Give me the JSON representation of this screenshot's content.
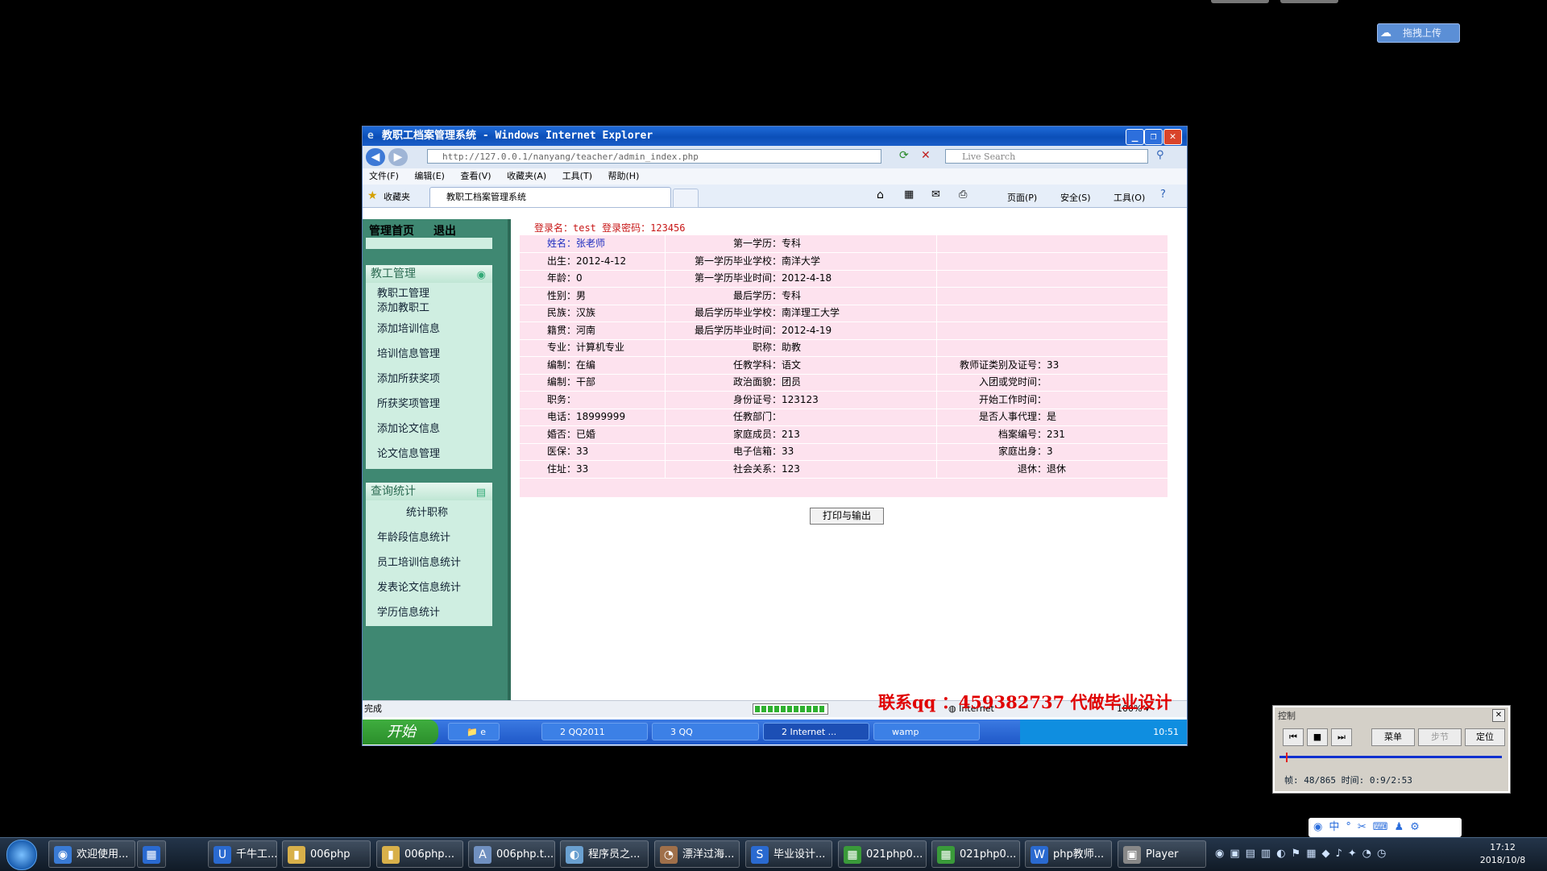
{
  "desktop": {
    "upload_label": "拖拽上传"
  },
  "ie": {
    "title": "教职工档案管理系统 - Windows Internet Explorer",
    "url": "http://127.0.0.1/nanyang/teacher/admin_index.php",
    "search_placeholder": "Live Search",
    "menu": [
      "文件(F)",
      "编辑(E)",
      "查看(V)",
      "收藏夹(A)",
      "工具(T)",
      "帮助(H)"
    ],
    "favorites_label": "收藏夹",
    "tab_title": "教职工档案管理系统",
    "commands": [
      "页面(P)",
      "安全(S)",
      "工具(O)"
    ],
    "status_text": "完成",
    "zone": "Internet",
    "zoom": "100%",
    "watermark": "联系qq ：459382737  代做毕业设计"
  },
  "page": {
    "top_nav": [
      "管理首页",
      "退出"
    ],
    "panel1": {
      "title": "教工管理",
      "items": [
        "教职工管理",
        "添加教职工",
        "添加培训信息",
        "培训信息管理",
        "添加所获奖项",
        "所获奖项管理",
        "添加论文信息",
        "论文信息管理"
      ]
    },
    "panel2": {
      "title": "查询统计",
      "items": [
        "统计职称",
        "年龄段信息统计",
        "员工培训信息统计",
        "发表论文信息统计",
        "学历信息统计"
      ]
    },
    "credentials": "登录名：test 登录密码：123456",
    "rows": [
      {
        "c1": "姓名：张老师",
        "l2": "第一学历：",
        "v2": "专科",
        "l3": "",
        "v3": ""
      },
      {
        "c1": "出生：2012-4-12",
        "l2": "第一学历毕业学校：",
        "v2": "南洋大学",
        "l3": "",
        "v3": ""
      },
      {
        "c1": "年龄：0",
        "l2": "第一学历毕业时间：",
        "v2": "2012-4-18",
        "l3": "",
        "v3": ""
      },
      {
        "c1": "性别：男",
        "l2": "最后学历：",
        "v2": "专科",
        "l3": "",
        "v3": ""
      },
      {
        "c1": "民族：汉族",
        "l2": "最后学历毕业学校：",
        "v2": "南洋理工大学",
        "l3": "",
        "v3": ""
      },
      {
        "c1": "籍贯：河南",
        "l2": "最后学历毕业时间：",
        "v2": "2012-4-19",
        "l3": "",
        "v3": ""
      },
      {
        "c1": "专业：计算机专业",
        "l2": "职称：",
        "v2": "助教",
        "l3": "",
        "v3": ""
      },
      {
        "c1": "编制：在编",
        "l2": "任教学科：",
        "v2": "语文",
        "l3": "教师证类别及证号：",
        "v3": "33"
      },
      {
        "c1": "编制：干部",
        "l2": "政治面貌：",
        "v2": "团员",
        "l3": "入团或党时间：",
        "v3": ""
      },
      {
        "c1": "职务：",
        "l2": "身份证号：",
        "v2": "123123",
        "l3": "开始工作时间：",
        "v3": ""
      },
      {
        "c1": "电话：18999999",
        "l2": "任教部门：",
        "v2": "",
        "l3": "是否人事代理：",
        "v3": "是"
      },
      {
        "c1": "婚否：已婚",
        "l2": "家庭成员：",
        "v2": "213",
        "l3": "档案编号：",
        "v3": "231"
      },
      {
        "c1": "医保：33",
        "l2": "电子信箱：",
        "v2": "33",
        "l3": "家庭出身：",
        "v3": "3"
      },
      {
        "c1": "住址：33",
        "l2": "社会关系：",
        "v2": "123",
        "l3": "退休：",
        "v3": "退休"
      }
    ],
    "print_button": "打印与输出"
  },
  "xp_taskbar": {
    "start": "开始",
    "buttons": [
      "2 QQ2011",
      "3 QQ",
      "2 Internet ...",
      "wamp"
    ],
    "time": "10:51"
  },
  "control": {
    "title": "控制",
    "buttons": [
      "菜单",
      "步节",
      "定位"
    ],
    "info": "帧: 48/865 时间: 0:9/2:53"
  },
  "taskbar": {
    "buttons": [
      "欢迎使用...",
      "",
      "千牛工...",
      "006php",
      "006php...",
      "006php.t...",
      "程序员之...",
      "漂洋过海...",
      "毕业设计...",
      "021php0...",
      "021php0...",
      "php教师...",
      "Player"
    ],
    "time": "17:12",
    "date": "2018/10/8"
  }
}
